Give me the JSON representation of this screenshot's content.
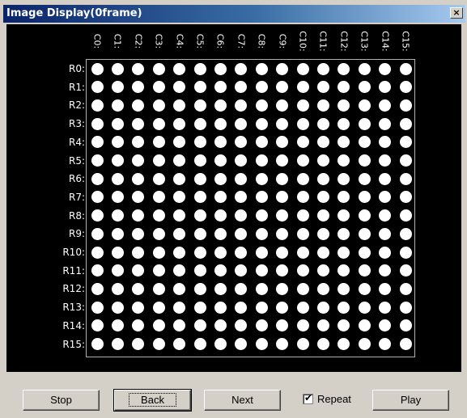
{
  "window": {
    "title": "Image Display(0frame)",
    "close_label": "×"
  },
  "grid": {
    "columns": [
      "C0:",
      "C1:",
      "C2:",
      "C3:",
      "C4:",
      "C5:",
      "C6:",
      "C7:",
      "C8:",
      "C9:",
      "C10:",
      "C11:",
      "C12:",
      "C13:",
      "C14:",
      "C15:"
    ],
    "rows": [
      "R0:",
      "R1:",
      "R2:",
      "R3:",
      "R4:",
      "R5:",
      "R6:",
      "R7:",
      "R8:",
      "R9:",
      "R10:",
      "R11:",
      "R12:",
      "R13:",
      "R14:",
      "R15:"
    ],
    "led_state": "all-on",
    "led_color": "#ffffff",
    "background_color": "#000000"
  },
  "controls": {
    "stop_label": "Stop",
    "back_label": "Back",
    "next_label": "Next",
    "repeat_label": "Repeat",
    "repeat_checked": true,
    "play_label": "Play"
  },
  "colors": {
    "titlebar_start": "#0a246a",
    "titlebar_end": "#a6caf0",
    "window_face": "#d4d0c8"
  }
}
